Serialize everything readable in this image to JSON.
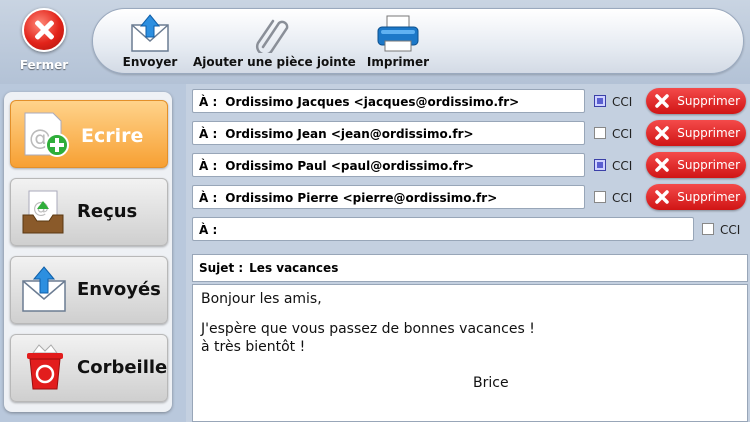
{
  "toolbar": {
    "close_label": "Fermer",
    "send_label": "Envoyer",
    "attach_label": "Ajouter une pièce jointe",
    "print_label": "Imprimer"
  },
  "sidebar": {
    "items": [
      {
        "label": "Ecrire",
        "icon": "compose-icon",
        "active": true
      },
      {
        "label": "Reçus",
        "icon": "inbox-icon",
        "active": false
      },
      {
        "label": "Envoyés",
        "icon": "sent-icon",
        "active": false
      },
      {
        "label": "Corbeille",
        "icon": "trash-icon",
        "active": false
      }
    ]
  },
  "recipients": {
    "prefix": "À :",
    "cci_label": "CCI",
    "delete_label": "Supprimer",
    "rows": [
      {
        "value": "Ordissimo Jacques <jacques@ordissimo.fr>",
        "cci": true
      },
      {
        "value": "Ordissimo Jean <jean@ordissimo.fr>",
        "cci": false
      },
      {
        "value": "Ordissimo Paul <paul@ordissimo.fr>",
        "cci": true
      },
      {
        "value": "Ordissimo Pierre <pierre@ordissimo.fr>",
        "cci": false
      }
    ],
    "empty_row": {
      "value": "",
      "cci": false
    }
  },
  "subject": {
    "prefix": "Sujet :",
    "value": "Les vacances"
  },
  "message": {
    "greeting": "Bonjour les amis,",
    "line1": "J'espère que vous passez de bonnes vacances !",
    "line2": "à très bientôt !",
    "signature": "Brice"
  },
  "colors": {
    "accent_orange": "#f7a033",
    "delete_red": "#d01515",
    "cci_checked": "#5a5fd0"
  }
}
